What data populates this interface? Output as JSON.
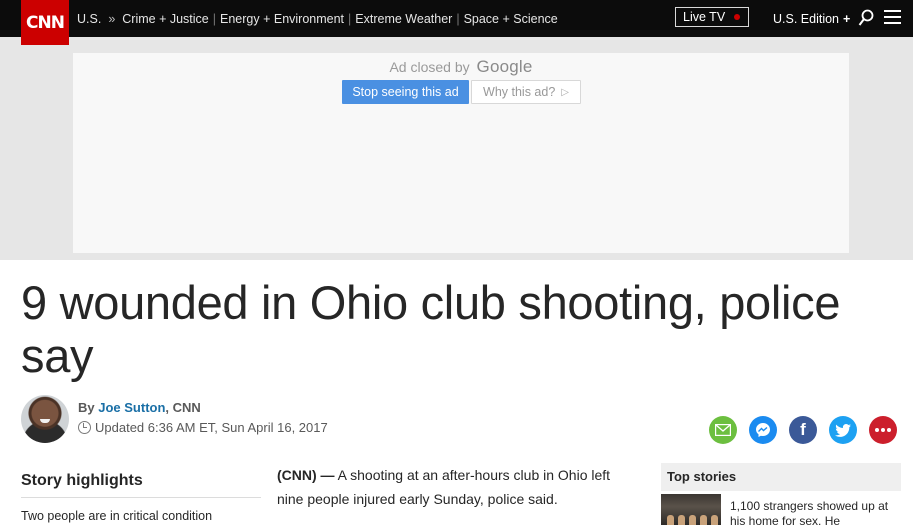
{
  "nav": {
    "logo": "CNN",
    "section": "U.S.",
    "arrow": "»",
    "links": [
      "Crime + Justice",
      "Energy + Environment",
      "Extreme Weather",
      "Space + Science"
    ],
    "live_tv": "Live TV",
    "edition": "U.S. Edition",
    "edition_plus": "+"
  },
  "ad": {
    "closed_prefix": "Ad closed by",
    "closed_brand": "Google",
    "stop_button": "Stop seeing this ad",
    "why_button": "Why this ad?"
  },
  "article": {
    "headline": "9 wounded in Ohio club shooting, police say",
    "byline_prefix": "By",
    "author": "Joe Sutton",
    "outlet": ", CNN",
    "updated": "Updated 6:36 AM ET, Sun April 16, 2017",
    "body_source": "(CNN) —",
    "body_text": " A shooting at an after-hours club in Ohio left nine people injured early Sunday, police said."
  },
  "highlights": {
    "title": "Story highlights",
    "items": [
      "Two people are in critical condition"
    ]
  },
  "top_stories": {
    "title": "Top stories",
    "items": [
      "1,100 strangers showed up at his home for sex. He"
    ]
  },
  "share": [
    "email-icon",
    "messenger-icon",
    "facebook-icon",
    "twitter-icon",
    "more-icon"
  ],
  "colors": {
    "brand_red": "#cc0000",
    "nav_bg": "#0c0c0c",
    "ad_blue": "#4a90e2",
    "author_link": "#1a6fa6"
  }
}
